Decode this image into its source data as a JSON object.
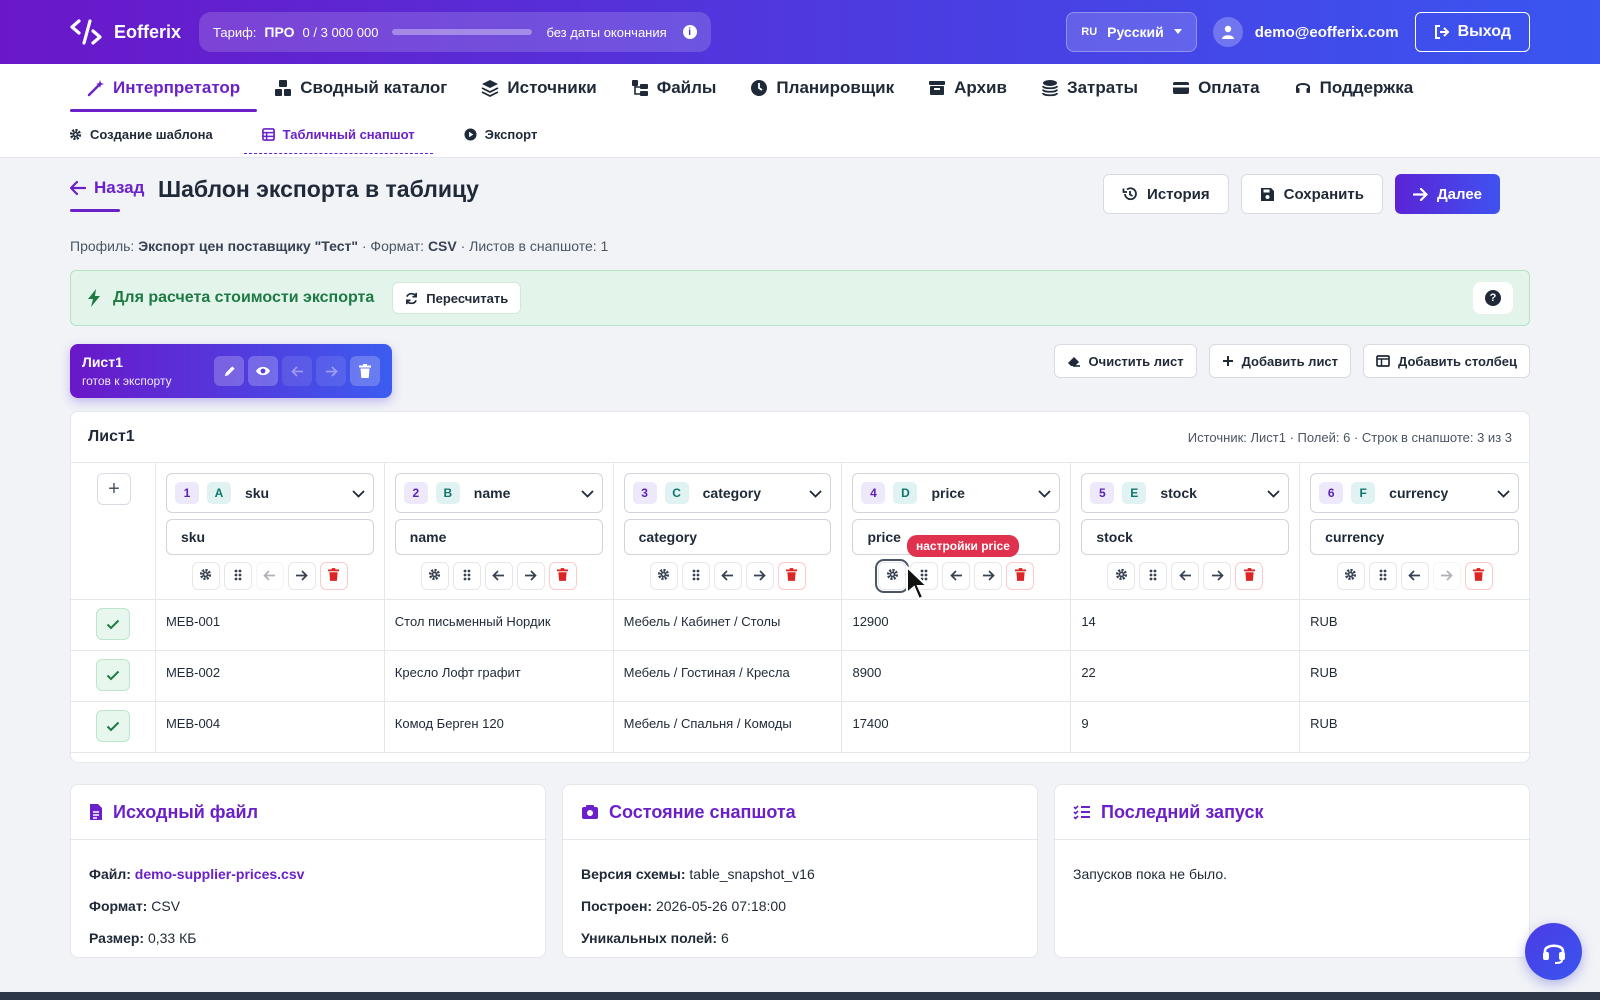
{
  "brand": {
    "name": "Eofferix"
  },
  "tariff": {
    "label": "Тариф:",
    "plan": "ПРО",
    "usage": "0 / 3 000 000",
    "expiry": "без даты окончания",
    "info": "i"
  },
  "language": {
    "code": "RU",
    "name": "Русский"
  },
  "user": {
    "email": "demo@eofferix.com"
  },
  "logout_label": "Выход",
  "main_nav": [
    {
      "label": "Интерпретатор",
      "icon": "wand-icon",
      "active": true
    },
    {
      "label": "Сводный каталог",
      "icon": "boxes-icon"
    },
    {
      "label": "Источники",
      "icon": "layers-icon"
    },
    {
      "label": "Файлы",
      "icon": "folder-tree-icon"
    },
    {
      "label": "Планировщик",
      "icon": "clock-icon"
    },
    {
      "label": "Архив",
      "icon": "archive-icon"
    },
    {
      "label": "Затраты",
      "icon": "coins-icon"
    },
    {
      "label": "Оплата",
      "icon": "card-icon"
    },
    {
      "label": "Поддержка",
      "icon": "headset-icon"
    }
  ],
  "sub_nav": [
    {
      "label": "Создание шаблона",
      "icon": "gear-icon"
    },
    {
      "label": "Табличный снапшот",
      "icon": "table-icon",
      "active": true
    },
    {
      "label": "Экспорт",
      "icon": "play-icon"
    }
  ],
  "page": {
    "back_label": "Назад",
    "title": "Шаблон экспорта в таблицу",
    "history_label": "История",
    "save_label": "Сохранить",
    "next_label": "Далее"
  },
  "meta": {
    "profile_label": "Профиль:",
    "profile_value": "Экспорт цен поставщику \"Тест\"",
    "sep1": " · Формат: ",
    "format_value": "CSV",
    "sheets_text": " · Листов в снапшоте: 1"
  },
  "alert": {
    "text": "Для расчета стоимости экспорта",
    "recalc_label": "Пересчитать",
    "help": "?"
  },
  "sheet_tab": {
    "name": "Лист1",
    "status": "готов к экспорту"
  },
  "sheet_actions": {
    "clear": "Очистить лист",
    "add_sheet": "Добавить лист",
    "add_column": "Добавить столбец"
  },
  "table": {
    "title": "Лист1",
    "summary": "Источник: Лист1 · Полей: 6 · Строк в снапшоте: 3 из 3",
    "add_row": "+",
    "columns": [
      {
        "num": "1",
        "letter": "A",
        "field": "sku",
        "header": "sku"
      },
      {
        "num": "2",
        "letter": "B",
        "field": "name",
        "header": "name"
      },
      {
        "num": "3",
        "letter": "C",
        "field": "category",
        "header": "category"
      },
      {
        "num": "4",
        "letter": "D",
        "field": "price",
        "header": "price"
      },
      {
        "num": "5",
        "letter": "E",
        "field": "stock",
        "header": "stock"
      },
      {
        "num": "6",
        "letter": "F",
        "field": "currency",
        "header": "currency"
      }
    ],
    "rows": [
      [
        "MEB-001",
        "Стол письменный Нордик",
        "Мебель / Кабинет / Столы",
        "12900",
        "14",
        "RUB"
      ],
      [
        "MEB-002",
        "Кресло Лофт графит",
        "Мебель / Гостиная / Кресла",
        "8900",
        "22",
        "RUB"
      ],
      [
        "MEB-004",
        "Комод Берген 120",
        "Мебель / Спальня / Комоды",
        "17400",
        "9",
        "RUB"
      ]
    ]
  },
  "tooltip": "настройки price",
  "source_card": {
    "title": "Исходный файл",
    "file_label": "Файл:",
    "file_value": "demo-supplier-prices.csv",
    "format_label": "Формат:",
    "format_value": "CSV",
    "size_label": "Размер:",
    "size_value": "0,33 КБ"
  },
  "snapshot_card": {
    "title": "Состояние снапшота",
    "schema_label": "Версия схемы:",
    "schema_value": "table_snapshot_v16",
    "built_label": "Построен:",
    "built_value": "2026-05-26 07:18:00",
    "unique_label": "Уникальных полей:",
    "unique_value": "6"
  },
  "run_card": {
    "title": "Последний запуск",
    "text": "Запусков пока не было."
  },
  "colors": {
    "accent": "#6b21c9",
    "brand_gradient_start": "#6a17c9",
    "brand_gradient_end": "#3a55f0",
    "success": "#1d7a45",
    "danger": "#e0314e"
  }
}
